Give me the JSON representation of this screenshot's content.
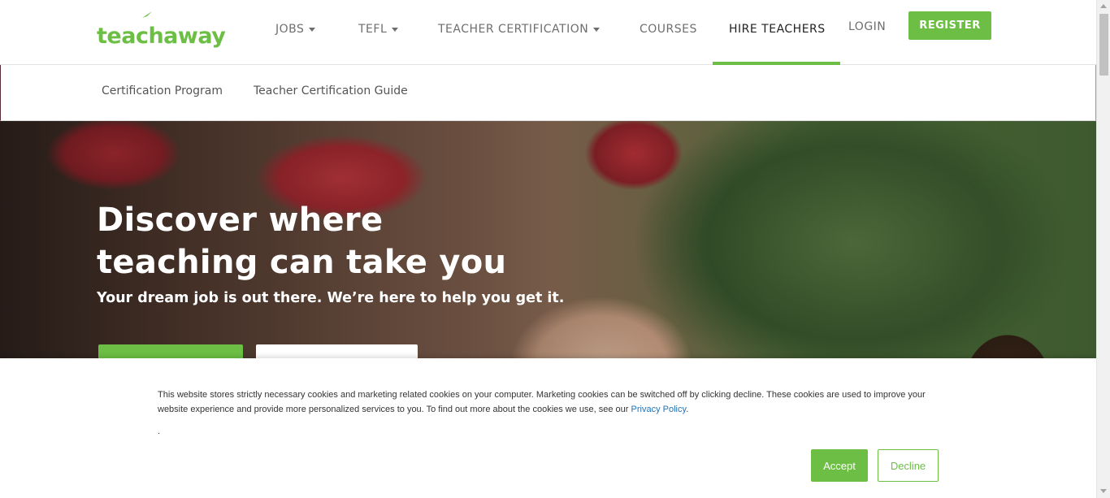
{
  "brand": {
    "name": "teachaway",
    "color": "#6cbf44"
  },
  "nav": {
    "items": [
      {
        "label": "JOBS",
        "dropdown": true
      },
      {
        "label": "TEFL",
        "dropdown": true
      },
      {
        "label": "TEACHER CERTIFICATION",
        "dropdown": true
      },
      {
        "label": "COURSES",
        "dropdown": false
      },
      {
        "label": "HIRE TEACHERS",
        "dropdown": false,
        "active": true
      }
    ],
    "login": "LOGIN",
    "register": "REGISTER"
  },
  "subnav": {
    "items": [
      "Certification Program",
      "Teacher Certification Guide"
    ]
  },
  "hero": {
    "title": "Discover where teaching can take you",
    "subtitle": "Your dream job is out there. We’re here to help you get it."
  },
  "cookie": {
    "text": "This website stores strictly necessary cookies and marketing related cookies on your computer. Marketing cookies can be switched off by clicking decline. These cookies are used to improve your website experience and provide more personalized services to you. To find out more about the cookies we use, see our ",
    "link": "Privacy Policy",
    "after_link": ".",
    "dot": ".",
    "accept": "Accept",
    "decline": "Decline"
  }
}
